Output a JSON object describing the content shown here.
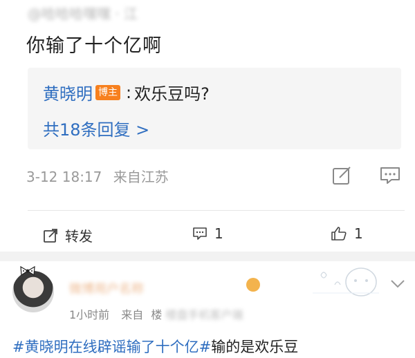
{
  "top_comment": {
    "header_blurred": "@哈哈哈嘿嘿 · 江",
    "text": "你输了十个亿啊",
    "reply": {
      "author": "黄晓明",
      "badge": "博主",
      "separator": ":",
      "text": "欢乐豆吗?"
    },
    "reply_count": "共18条回复 >",
    "timestamp": "3-12 18:17",
    "location": "来自江苏"
  },
  "action_bar": {
    "repost_label": "转发",
    "comment_count": "1",
    "like_count": "1"
  },
  "post": {
    "username_blurred": "微博用户名称",
    "time": "1小时前",
    "from_label": "来自",
    "source_prefix": "楼",
    "source_blurred": "楼盘手机客户端",
    "hashtag": "#黄晓明在线辟谣输了十个亿#",
    "text": "输的是欢乐豆"
  },
  "colors": {
    "link": "#2f6ec0",
    "badge": "#f7801e",
    "username": "#e0833a"
  }
}
